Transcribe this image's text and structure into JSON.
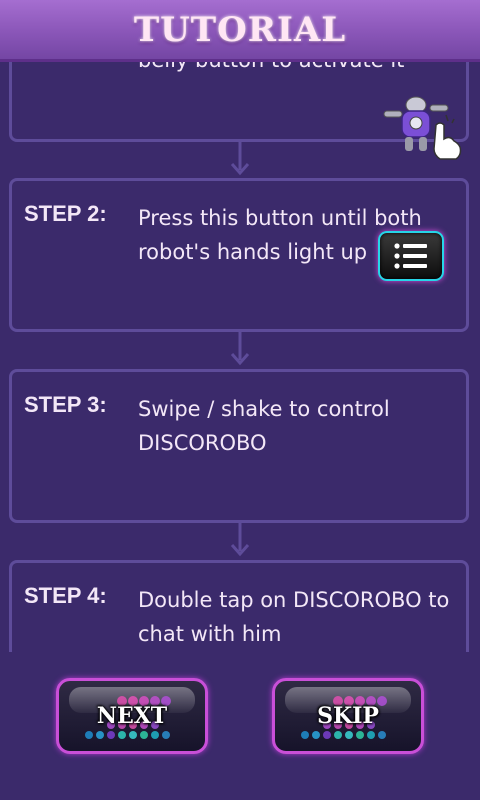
{
  "header": {
    "title": "TUTORIAL"
  },
  "steps": [
    {
      "text": "belly button to activate it",
      "icon": "robot-icon"
    },
    {
      "label": "STEP 2:",
      "text": "Press this button until both robot's hands light up",
      "icon": "menu-list-icon"
    },
    {
      "label": "STEP 3:",
      "text": "Swipe / shake to control DISCOROBO"
    },
    {
      "label": "STEP 4:",
      "text": "Double tap on DISCOROBO to chat with him"
    }
  ],
  "buttons": {
    "next_label": "NEXT",
    "skip_label": "SKIP"
  },
  "colors": {
    "background": "#3b2a6b",
    "header": "#8a56b8",
    "card_border": "#5e4c9a",
    "text": "#f3e7f7",
    "button_border": "#c94fd8",
    "menu_button_border": "#26d6e8"
  }
}
